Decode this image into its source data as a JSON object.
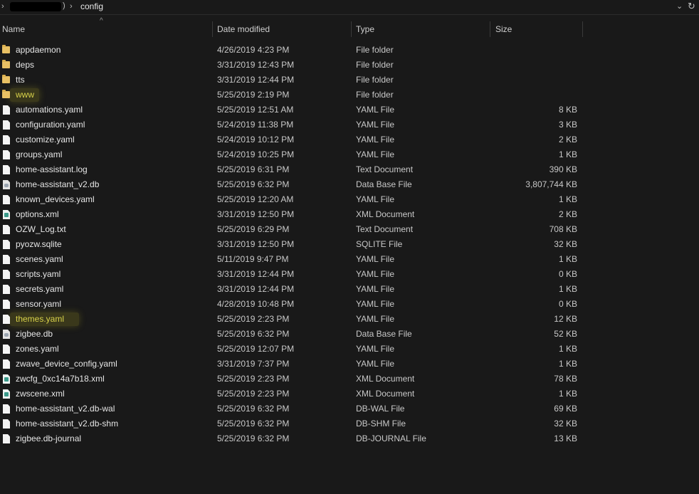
{
  "address": {
    "current_folder": "config",
    "separator_glyph": "›",
    "path_end_glyph": ")",
    "dropdown_glyph": "⌄",
    "refresh_glyph": "↻"
  },
  "columns": {
    "name": "Name",
    "date": "Date modified",
    "type": "Type",
    "size": "Size"
  },
  "files": [
    {
      "name": "appdaemon",
      "date": "4/26/2019 4:23 PM",
      "type": "File folder",
      "size": "",
      "icon": "folder-icon"
    },
    {
      "name": "deps",
      "date": "3/31/2019 12:43 PM",
      "type": "File folder",
      "size": "",
      "icon": "folder-icon"
    },
    {
      "name": "tts",
      "date": "3/31/2019 12:44 PM",
      "type": "File folder",
      "size": "",
      "icon": "folder-icon"
    },
    {
      "name": "www",
      "date": "5/25/2019 2:19 PM",
      "type": "File folder",
      "size": "",
      "icon": "folder-icon",
      "highlight": true
    },
    {
      "name": "automations.yaml",
      "date": "5/25/2019 12:51 AM",
      "type": "YAML File",
      "size": "8 KB",
      "icon": "file-icon"
    },
    {
      "name": "configuration.yaml",
      "date": "5/24/2019 11:38 PM",
      "type": "YAML File",
      "size": "3 KB",
      "icon": "file-icon"
    },
    {
      "name": "customize.yaml",
      "date": "5/24/2019 10:12 PM",
      "type": "YAML File",
      "size": "2 KB",
      "icon": "file-icon"
    },
    {
      "name": "groups.yaml",
      "date": "5/24/2019 10:25 PM",
      "type": "YAML File",
      "size": "1 KB",
      "icon": "file-icon"
    },
    {
      "name": "home-assistant.log",
      "date": "5/25/2019 6:31 PM",
      "type": "Text Document",
      "size": "390 KB",
      "icon": "file-icon"
    },
    {
      "name": "home-assistant_v2.db",
      "date": "5/25/2019 6:32 PM",
      "type": "Data Base File",
      "size": "3,807,744 KB",
      "icon": "database-file-icon"
    },
    {
      "name": "known_devices.yaml",
      "date": "5/25/2019 12:20 AM",
      "type": "YAML File",
      "size": "1 KB",
      "icon": "file-icon"
    },
    {
      "name": "options.xml",
      "date": "3/31/2019 12:50 PM",
      "type": "XML Document",
      "size": "2 KB",
      "icon": "xml-file-icon"
    },
    {
      "name": "OZW_Log.txt",
      "date": "5/25/2019 6:29 PM",
      "type": "Text Document",
      "size": "708 KB",
      "icon": "file-icon"
    },
    {
      "name": "pyozw.sqlite",
      "date": "3/31/2019 12:50 PM",
      "type": "SQLITE File",
      "size": "32 KB",
      "icon": "file-icon"
    },
    {
      "name": "scenes.yaml",
      "date": "5/11/2019 9:47 PM",
      "type": "YAML File",
      "size": "1 KB",
      "icon": "file-icon"
    },
    {
      "name": "scripts.yaml",
      "date": "3/31/2019 12:44 PM",
      "type": "YAML File",
      "size": "0 KB",
      "icon": "file-icon"
    },
    {
      "name": "secrets.yaml",
      "date": "3/31/2019 12:44 PM",
      "type": "YAML File",
      "size": "1 KB",
      "icon": "file-icon"
    },
    {
      "name": "sensor.yaml",
      "date": "4/28/2019 10:48 PM",
      "type": "YAML File",
      "size": "0 KB",
      "icon": "file-icon"
    },
    {
      "name": "themes.yaml",
      "date": "5/25/2019 2:23 PM",
      "type": "YAML File",
      "size": "12 KB",
      "icon": "file-icon",
      "highlight": true
    },
    {
      "name": "zigbee.db",
      "date": "5/25/2019 6:32 PM",
      "type": "Data Base File",
      "size": "52 KB",
      "icon": "database-file-icon"
    },
    {
      "name": "zones.yaml",
      "date": "5/25/2019 12:07 PM",
      "type": "YAML File",
      "size": "1 KB",
      "icon": "file-icon"
    },
    {
      "name": "zwave_device_config.yaml",
      "date": "3/31/2019 7:37 PM",
      "type": "YAML File",
      "size": "1 KB",
      "icon": "file-icon"
    },
    {
      "name": "zwcfg_0xc14a7b18.xml",
      "date": "5/25/2019 2:23 PM",
      "type": "XML Document",
      "size": "78 KB",
      "icon": "xml-file-icon"
    },
    {
      "name": "zwscene.xml",
      "date": "5/25/2019 2:23 PM",
      "type": "XML Document",
      "size": "1 KB",
      "icon": "xml-file-icon"
    },
    {
      "name": "home-assistant_v2.db-wal",
      "date": "5/25/2019 6:32 PM",
      "type": "DB-WAL File",
      "size": "69 KB",
      "icon": "file-icon"
    },
    {
      "name": "home-assistant_v2.db-shm",
      "date": "5/25/2019 6:32 PM",
      "type": "DB-SHM File",
      "size": "32 KB",
      "icon": "file-icon"
    },
    {
      "name": "zigbee.db-journal",
      "date": "5/25/2019 6:32 PM",
      "type": "DB-JOURNAL File",
      "size": "13 KB",
      "icon": "file-icon"
    }
  ]
}
